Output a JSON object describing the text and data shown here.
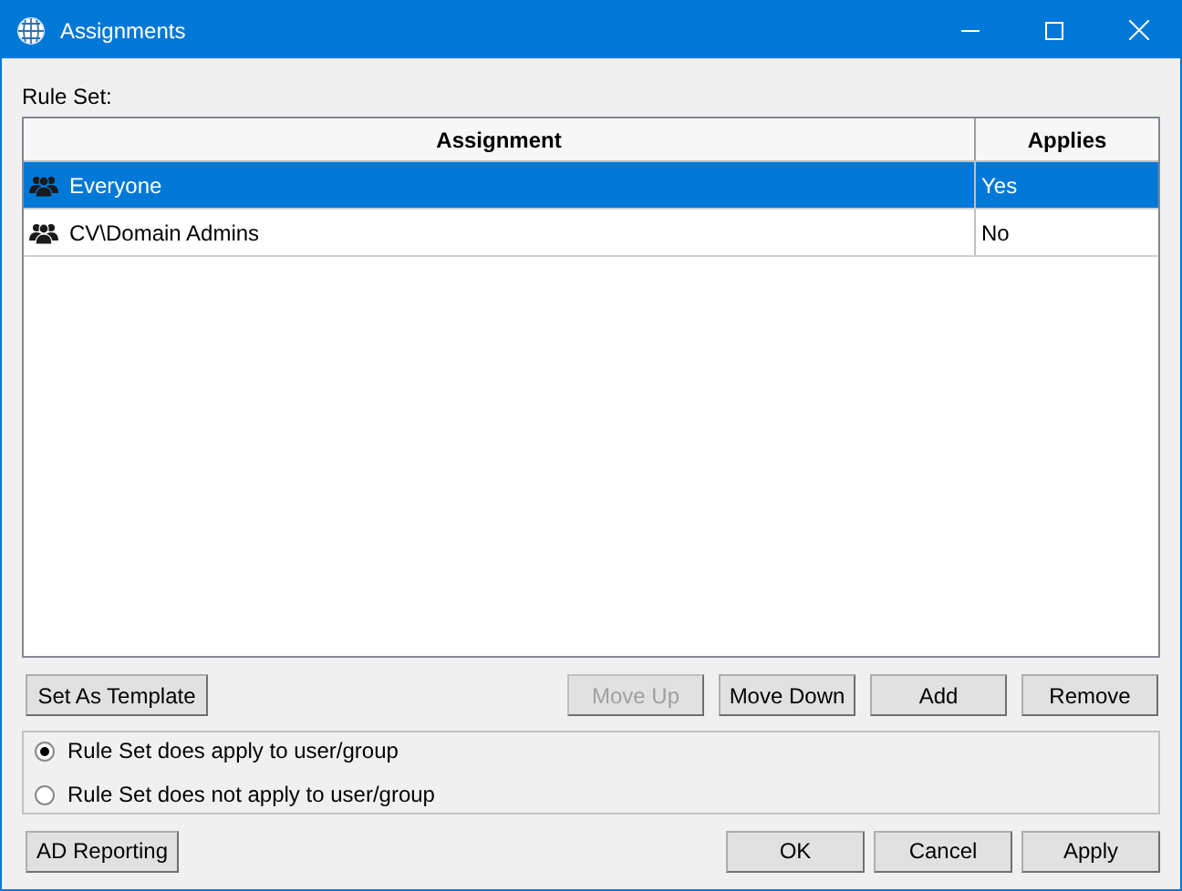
{
  "window": {
    "title": "Assignments"
  },
  "rule_set_label": "Rule Set:",
  "table": {
    "columns": [
      "Assignment",
      "Applies"
    ],
    "rows": [
      {
        "assignment": "Everyone",
        "applies": "Yes",
        "selected": true
      },
      {
        "assignment": "CV\\Domain Admins",
        "applies": "No",
        "selected": false
      }
    ]
  },
  "template_button": {
    "label": "Set As Template",
    "disabled": false
  },
  "list_buttons": [
    {
      "label": "Move Up",
      "disabled": true
    },
    {
      "label": "Move Down",
      "disabled": false
    },
    {
      "label": "Add",
      "disabled": false
    },
    {
      "label": "Remove",
      "disabled": false
    }
  ],
  "options": [
    {
      "label": "Rule Set does apply to user/group",
      "selected": true
    },
    {
      "label": "Rule Set does not apply to user/group",
      "selected": false
    }
  ],
  "report_button": {
    "label": "AD Reporting",
    "disabled": false
  },
  "dialog_buttons": [
    {
      "label": "OK",
      "disabled": false
    },
    {
      "label": "Cancel",
      "disabled": false
    },
    {
      "label": "Apply",
      "disabled": false
    }
  ]
}
